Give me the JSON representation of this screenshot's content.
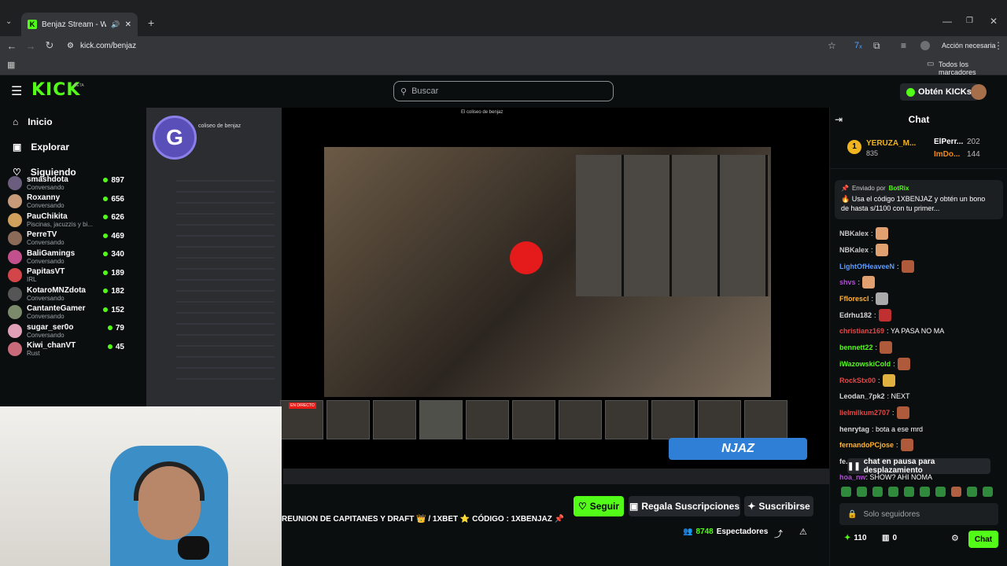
{
  "browser": {
    "tab_title": "Benjaz Stream - Watch Live",
    "url": "kick.com/benjaz",
    "action_label": "Acción necesaria",
    "bookmarks_label": "Todos los marcadores"
  },
  "header": {
    "logo": "KICK",
    "logo_badge": "BETA",
    "search_placeholder": "Buscar",
    "kicks_button": "Obtén KICKs"
  },
  "sidebar": {
    "nav": [
      {
        "label": "Inicio",
        "icon": "home-icon"
      },
      {
        "label": "Explorar",
        "icon": "compass-icon"
      },
      {
        "label": "Siguiendo",
        "icon": "heart-icon"
      }
    ],
    "channels": [
      {
        "name": "smashdota",
        "sub": "Conversando",
        "viewers": "897"
      },
      {
        "name": "Roxanny",
        "sub": "Conversando",
        "viewers": "656"
      },
      {
        "name": "PauChikita",
        "sub": "Piscinas, jacuzzis y bi...",
        "viewers": "626"
      },
      {
        "name": "PerreTV",
        "sub": "Conversando",
        "viewers": "469"
      },
      {
        "name": "BaliGamings",
        "sub": "Conversando",
        "viewers": "340"
      },
      {
        "name": "PapitasVT",
        "sub": "IRL",
        "viewers": "189"
      },
      {
        "name": "KotaroMNZdota",
        "sub": "Conversando",
        "viewers": "182"
      },
      {
        "name": "CantanteGamer",
        "sub": "Conversando",
        "viewers": "152"
      },
      {
        "name": "sugar_ser0o",
        "sub": "Conversando",
        "viewers": "79"
      },
      {
        "name": "Kiwi_chanVT",
        "sub": "Rust",
        "viewers": "45"
      }
    ]
  },
  "player": {
    "discord_server": "coliseo de benjaz",
    "discord_window_title": "El coliseo de benjaz",
    "overlay_text": "NJAZ",
    "live_badge": "EN DIRECTO"
  },
  "stream": {
    "title": "REUNION DE CAPITANES Y DRAFT 👑 / 1XBET ⭐ CÓDIGO : 1XBENJAZ 📌",
    "follow_button": "Seguir",
    "gift_button": "Regala Suscripciones",
    "subscribe_button": "Suscribirse",
    "viewers": "8748",
    "viewers_label": "Espectadores"
  },
  "chat": {
    "header": "Chat",
    "leaderboard": [
      {
        "rank": "1",
        "name": "YERUZA_M...",
        "value": "835"
      },
      {
        "name": "ElPerr...",
        "value": "202"
      },
      {
        "name": "ImDo...",
        "value": "144"
      }
    ],
    "pinned": {
      "sent_by_label": "Enviado por",
      "sender": "BotRix",
      "text": "🔥 Usa el código 1XBENJAZ y obtén un bono de hasta s/1100 con tu primer..."
    },
    "messages": [
      {
        "user": "NBKalex",
        "text": "",
        "color": "#c8c8c8",
        "emote": true
      },
      {
        "user": "NBKalex",
        "text": "",
        "color": "#c8c8c8",
        "emote": true
      },
      {
        "user": "LightOfHeaveeN",
        "text": "",
        "color": "#5b9bff",
        "emote": true
      },
      {
        "user": "shvs",
        "text": "",
        "color": "#b34bd8",
        "emote": true
      },
      {
        "user": "Fflorescl",
        "text": "",
        "color": "#ffb43b",
        "emote": true
      },
      {
        "user": "Edrhu182",
        "text": "",
        "color": "#d8d8d8",
        "emote": true
      },
      {
        "user": "christianz169",
        "text": "YA PASA NO MA",
        "color": "#e14848",
        "emote": false
      },
      {
        "user": "bennett22",
        "text": "",
        "color": "#53fc18",
        "emote": true
      },
      {
        "user": "iWazowskiCold",
        "text": "",
        "color": "#53fc18",
        "emote": true
      },
      {
        "user": "RockStx00",
        "text": "",
        "color": "#e14848",
        "emote": true
      },
      {
        "user": "Leodan_7pk2",
        "text": "NEXT",
        "color": "#d8d8d8",
        "emote": false
      },
      {
        "user": "lielmilkum2707",
        "text": "",
        "color": "#e14848",
        "emote": true
      },
      {
        "user": "henrytag",
        "text": "bota a ese mrd",
        "color": "#d8d8d8",
        "emote": false
      },
      {
        "user": "fernandoPCjose",
        "text": "",
        "color": "#ffb43b",
        "emote": true
      },
      {
        "user": "fe...",
        "text": "",
        "color": "#d8d8d8",
        "emote": false
      },
      {
        "user": "hoa_nw",
        "text": "SHOW? AHI NOMA",
        "color": "#b34bd8",
        "emote": false
      }
    ],
    "paused_label": "chat en pausa para desplazamiento",
    "input_placeholder": "Solo seguidores",
    "points": "110",
    "rewards": "0",
    "send_button": "Chat"
  }
}
